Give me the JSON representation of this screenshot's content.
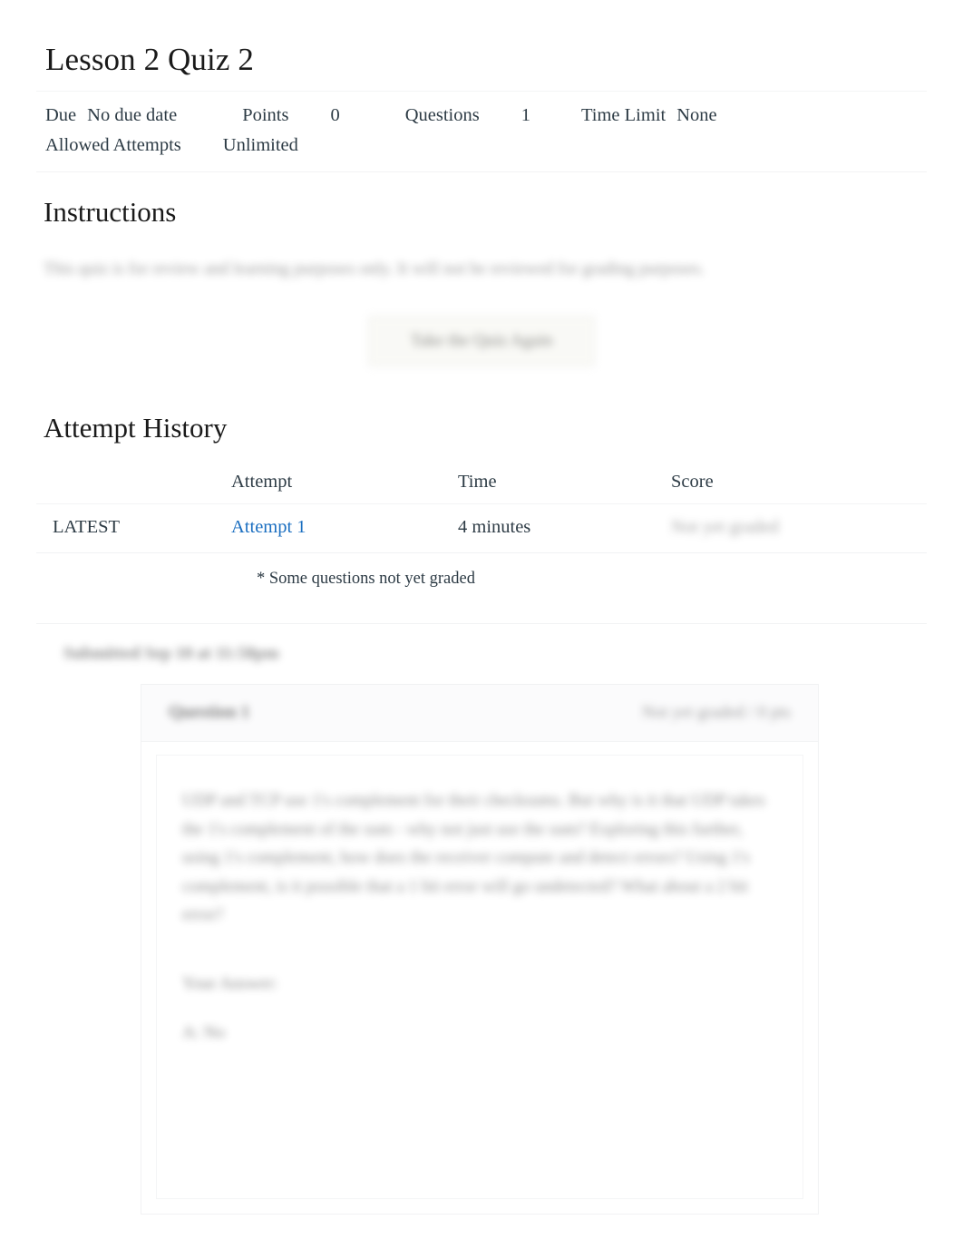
{
  "quiz": {
    "title": "Lesson 2 Quiz 2",
    "meta": {
      "due_label": "Due",
      "due_value": "No due date",
      "points_label": "Points",
      "points_value": "0",
      "questions_label": "Questions",
      "questions_value": "1",
      "time_limit_label": "Time Limit",
      "time_limit_value": "None",
      "allowed_attempts_label": "Allowed Attempts",
      "allowed_attempts_value": "Unlimited"
    }
  },
  "instructions": {
    "heading": "Instructions",
    "body": "This quiz is for review and learning purposes only. It will not be reviewed for grading purposes."
  },
  "actions": {
    "take_quiz_again": "Take the Quiz Again"
  },
  "attempt_history": {
    "heading": "Attempt History",
    "columns": [
      "",
      "Attempt",
      "Time",
      "Score"
    ],
    "rows": [
      {
        "kept": "LATEST",
        "attempt": "Attempt 1",
        "time": "4 minutes",
        "score": "Not yet graded"
      }
    ],
    "note": "* Some questions not yet graded"
  },
  "submission": {
    "submitted_line": "Submitted Sep 10 at 11:58pm"
  },
  "question": {
    "number_label": "Question 1",
    "status_label": "Not yet graded / 0 pts",
    "text": "UDP and TCP use 1's complement for their checksums. But why is it that UDP takes the 1's complement of the sum - why not just use the sum? Exploring this further, using 1's complement, how does the receiver compute and detect errors? Using 1's complement, is it possible that a 1 bit error will go undetected? What about a 2 bit error?",
    "answer_label": "Your Answer:",
    "answer_value": "A: No"
  },
  "colors": {
    "link": "#1a6ec0",
    "text": "#2d3b45",
    "heading": "#1a1a1a",
    "divider": "#f2f3f4",
    "button_bg": "#f7f7f2"
  }
}
